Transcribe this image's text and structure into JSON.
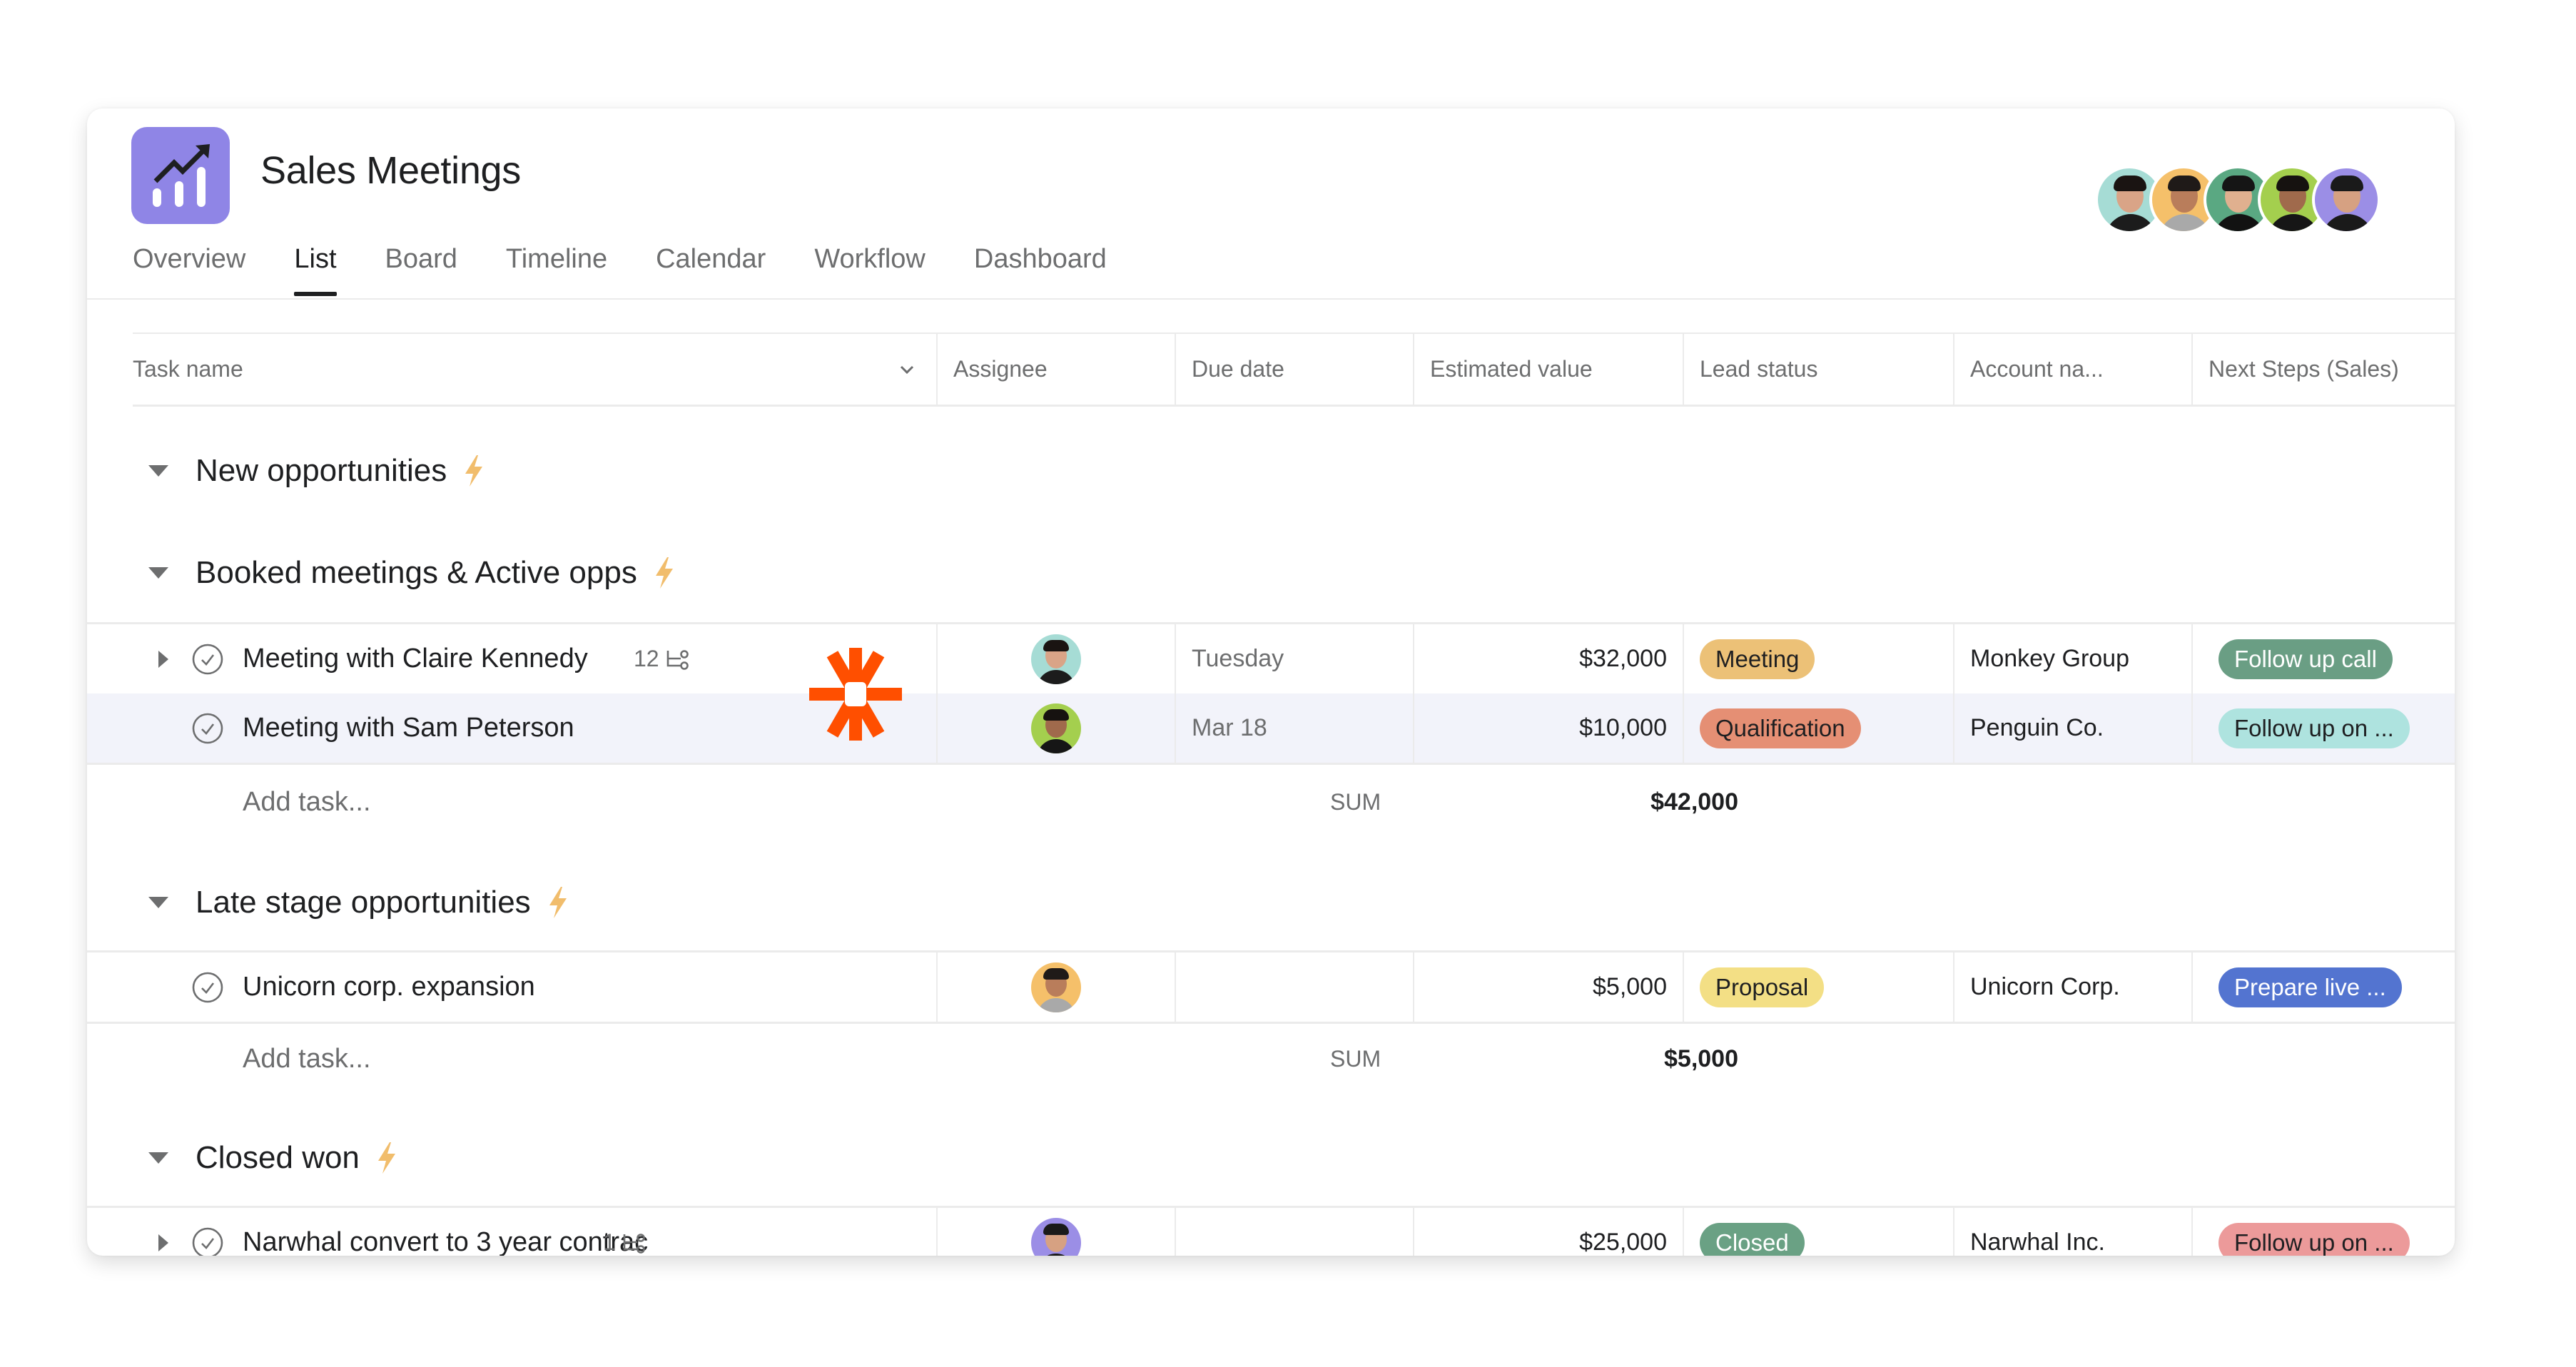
{
  "project": {
    "title": "Sales Meetings",
    "icon": "trending-chart-icon",
    "icon_color": "#8f85e6"
  },
  "members": [
    {
      "name": "member-1",
      "bg": "#a6dcd5",
      "hair": "#1a1412",
      "skin": "#d9a487",
      "shirt": "#1c1c1c"
    },
    {
      "name": "member-2",
      "bg": "#f5c06a",
      "hair": "#1f1a18",
      "skin": "#b97d5b",
      "shirt": "#a9a9a9"
    },
    {
      "name": "member-3",
      "bg": "#5aa882",
      "hair": "#151515",
      "skin": "#e0b08f",
      "shirt": "#121212"
    },
    {
      "name": "member-4",
      "bg": "#a4cf4e",
      "hair": "#161210",
      "skin": "#a06a4c",
      "shirt": "#161616"
    },
    {
      "name": "member-5",
      "bg": "#9b8ee6",
      "hair": "#1a1a1a",
      "skin": "#d6a182",
      "shirt": "#1a1a1a"
    }
  ],
  "tabs": [
    {
      "label": "Overview",
      "active": false
    },
    {
      "label": "List",
      "active": true
    },
    {
      "label": "Board",
      "active": false
    },
    {
      "label": "Timeline",
      "active": false
    },
    {
      "label": "Calendar",
      "active": false
    },
    {
      "label": "Workflow",
      "active": false
    },
    {
      "label": "Dashboard",
      "active": false
    }
  ],
  "columns": [
    "Task name",
    "Assignee",
    "Due date",
    "Estimated value",
    "Lead status",
    "Account na...",
    "Next Steps (Sales)"
  ],
  "sections": [
    {
      "title": "New opportunities",
      "tasks": []
    },
    {
      "title": "Booked meetings & Active opps",
      "tasks": [
        {
          "name": "Meeting with Claire Kennedy",
          "subtasks": "12",
          "expandable": true,
          "assignee": 0,
          "due": "Tuesday",
          "value": "$32,000",
          "lead_status": {
            "label": "Meeting",
            "bg": "#ecc177",
            "fg": "#1e1f21"
          },
          "account": "Monkey Group",
          "next_step": {
            "label": "Follow up call",
            "bg": "#6a9e84",
            "fg": "#ffffff"
          },
          "highlighted": false
        },
        {
          "name": "Meeting with Sam Peterson",
          "subtasks": "",
          "expandable": false,
          "assignee": 3,
          "due": "Mar 18",
          "value": "$10,000",
          "lead_status": {
            "label": "Qualification",
            "bg": "#e58f74",
            "fg": "#1e1f21"
          },
          "account": "Penguin Co.",
          "next_step": {
            "label": "Follow up on ...",
            "bg": "#aee3df",
            "fg": "#1e1f21"
          },
          "highlighted": true
        }
      ],
      "add_task": "Add task...",
      "sum_label": "SUM",
      "sum": "$42,000"
    },
    {
      "title": "Late stage opportunities",
      "tasks": [
        {
          "name": "Unicorn corp. expansion",
          "subtasks": "",
          "expandable": false,
          "assignee": 1,
          "due": "",
          "value": "$5,000",
          "lead_status": {
            "label": "Proposal",
            "bg": "#f3df85",
            "fg": "#1e1f21"
          },
          "account": "Unicorn Corp.",
          "next_step": {
            "label": "Prepare live ...",
            "bg": "#5374d0",
            "fg": "#ffffff"
          },
          "highlighted": false
        }
      ],
      "add_task": "Add task...",
      "sum_label": "SUM",
      "sum": "$5,000"
    },
    {
      "title": "Closed won",
      "tasks": [
        {
          "name": "Narwhal convert to 3 year contrac",
          "subtasks": "1",
          "expandable": true,
          "assignee": 4,
          "due": "",
          "value": "$25,000",
          "lead_status": {
            "label": "Closed",
            "bg": "#6aa184",
            "fg": "#ffffff"
          },
          "account": "Narwhal Inc.",
          "next_step": {
            "label": "Follow up on ...",
            "bg": "#ec9a9a",
            "fg": "#1e1f21"
          },
          "highlighted": false
        }
      ]
    }
  ],
  "overlay": {
    "logo": "zapier-asterisk-icon",
    "color": "#ff4f00"
  },
  "accent": {
    "bolt": "#f1bd6c"
  }
}
